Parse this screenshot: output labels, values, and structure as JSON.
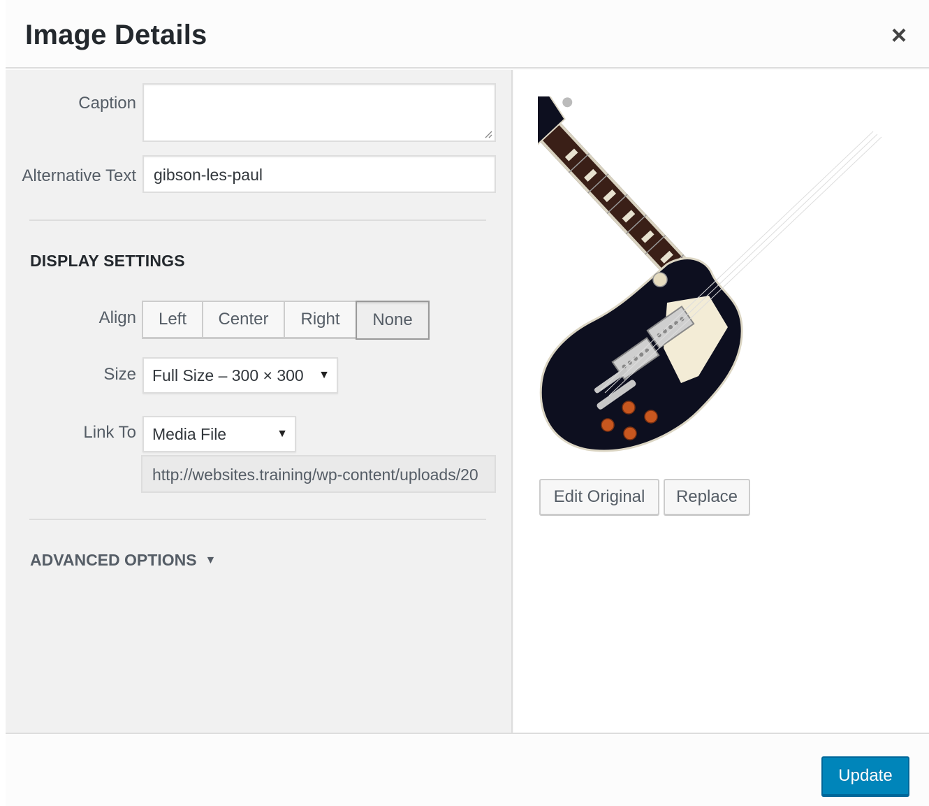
{
  "modal": {
    "title": "Image Details",
    "close_symbol": "×"
  },
  "fields": {
    "caption_label": "Caption",
    "caption_value": "",
    "alt_label": "Alternative Text",
    "alt_value": "gibson-les-paul"
  },
  "display_settings": {
    "heading": "DISPLAY SETTINGS",
    "align_label": "Align",
    "align_options": [
      "Left",
      "Center",
      "Right",
      "None"
    ],
    "align_selected": "None",
    "size_label": "Size",
    "size_value": "Full Size – 300 × 300",
    "link_label": "Link To",
    "link_value": "Media File",
    "link_url": "http://websites.training/wp-content/uploads/20"
  },
  "advanced": {
    "label": "ADVANCED OPTIONS",
    "arrow": "▼"
  },
  "preview": {
    "edit_label": "Edit Original",
    "replace_label": "Replace"
  },
  "footer": {
    "update_label": "Update"
  },
  "colors": {
    "primary": "#0085ba",
    "pane_bg": "#f1f1f1",
    "guitar_body": "#0d0f1f",
    "pickguard": "#f3ecd6",
    "knobs": "#c8571f"
  }
}
